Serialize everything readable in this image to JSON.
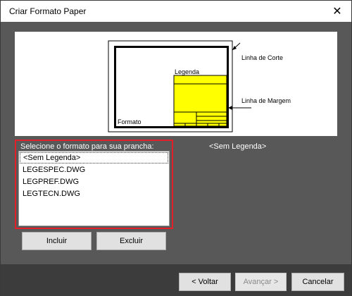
{
  "window": {
    "title": "Criar Formato Paper",
    "close_glyph": "✕"
  },
  "preview": {
    "legenda_label": "Legenda",
    "formato_label": "Formato",
    "linha_corte_label": "Linha de Corte",
    "linha_margem_label": "Linha de Margem",
    "legend_fill_color": "#ffff00"
  },
  "selector": {
    "label": "Selecione o formato para sua prancha:",
    "items": [
      "<Sem Legenda>",
      "LEGESPEC.DWG",
      "LEGPREF.DWG",
      "LEGTECN.DWG"
    ],
    "selected_value": "<Sem Legenda>"
  },
  "selected_display": "<Sem Legenda>",
  "buttons": {
    "incluir": "Incluir",
    "excluir": "Excluir",
    "voltar": "< Voltar",
    "avancar": "Avançar >",
    "cancelar": "Cancelar"
  }
}
